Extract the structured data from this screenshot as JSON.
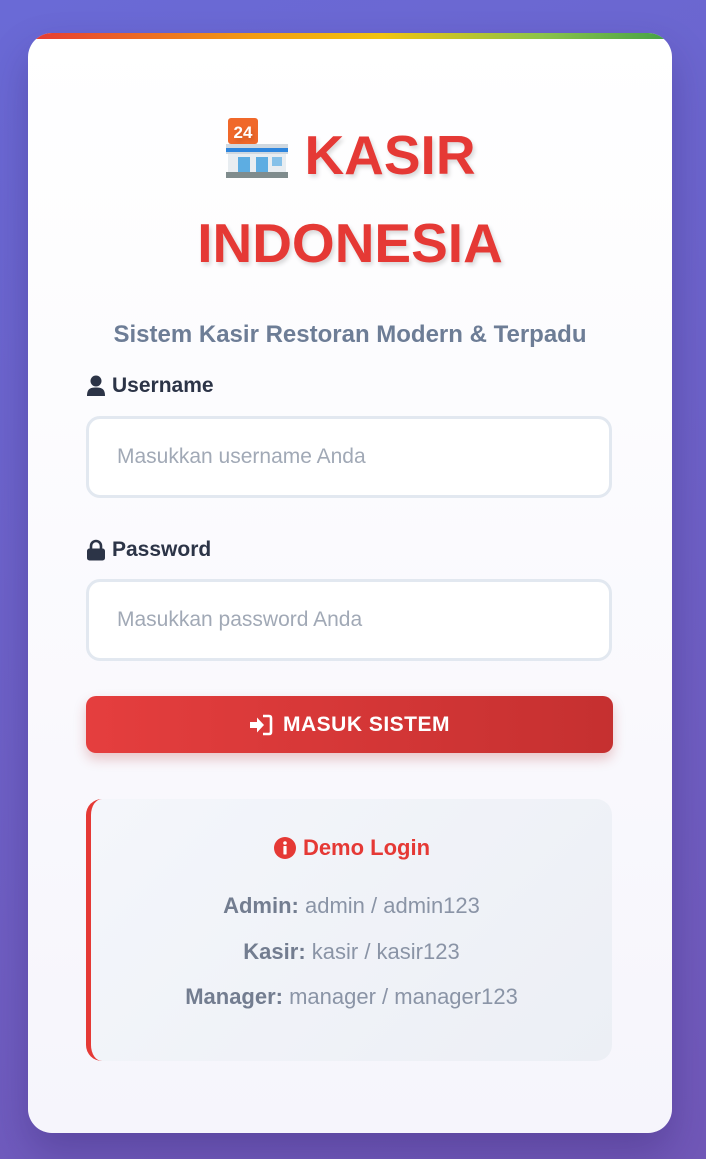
{
  "app": {
    "title_line1": "KASIR",
    "title_line2": "INDONESIA",
    "subtitle": "Sistem Kasir Restoran Modern & Terpadu",
    "store_icon": "convenience-store-24-emoji",
    "accent_color": "#e53935"
  },
  "form": {
    "username_label": "Username",
    "username_placeholder": "Masukkan username Anda",
    "username_value": "",
    "password_label": "Password",
    "password_placeholder": "Masukkan password Anda",
    "password_value": "",
    "submit_label": "MASUK SISTEM"
  },
  "demo": {
    "title": "Demo Login",
    "accounts": [
      {
        "role": "Admin:",
        "credentials": "admin / admin123"
      },
      {
        "role": "Kasir:",
        "credentials": "kasir / kasir123"
      },
      {
        "role": "Manager:",
        "credentials": "manager / manager123"
      }
    ]
  }
}
